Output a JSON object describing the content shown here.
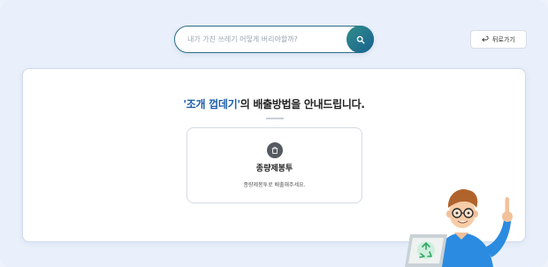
{
  "search": {
    "placeholder": "내가 가진 쓰레기 어떻게 버리야할까?"
  },
  "back_button": {
    "label": "뒤로가기"
  },
  "result": {
    "quote_open": "'",
    "item_name": "조개 껍데기",
    "quote_close": "'",
    "heading_suffix": "의 배출방법을 안내드립니다.",
    "method_title": "종량제봉투",
    "method_description": "종량제봉투로 배출해주세요."
  },
  "icons": {
    "search": "search-icon",
    "back": "back-arrow-icon",
    "method": "trash-bag-icon",
    "recycle": "recycle-icon"
  },
  "colors": {
    "accent": "#1d5fa8",
    "search_button_start": "#2f8f8a",
    "search_button_end": "#1a5f8f",
    "page_background": "#e9f0fb"
  }
}
